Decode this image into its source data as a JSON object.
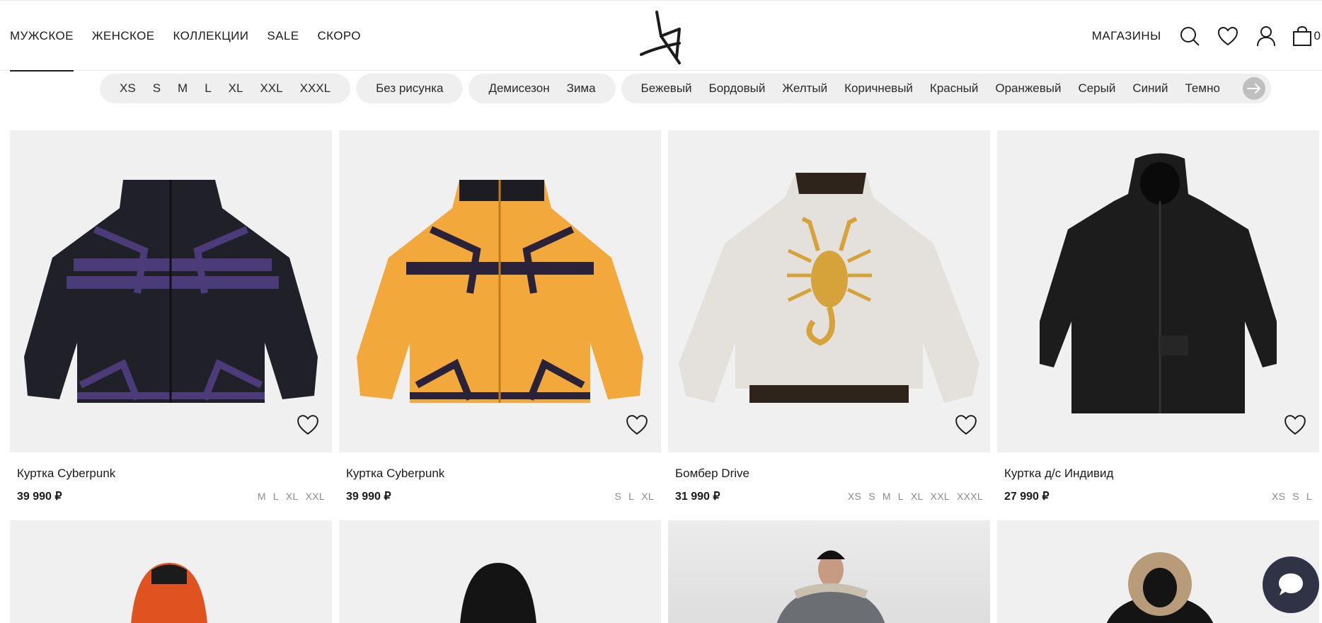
{
  "header": {
    "nav": [
      {
        "label": "МУЖСКОЕ",
        "active": true
      },
      {
        "label": "ЖЕНСКОЕ"
      },
      {
        "label": "КОЛЛЕКЦИИ"
      },
      {
        "label": "SALE"
      },
      {
        "label": "СКОРО"
      }
    ],
    "stores_label": "МАГАЗИНЫ",
    "cart_count": "0"
  },
  "filters": {
    "sizes": [
      "XS",
      "S",
      "M",
      "L",
      "XL",
      "XXL",
      "XXXL"
    ],
    "pattern": [
      "Без рисунка"
    ],
    "season": [
      "Демисезон",
      "Зима"
    ],
    "colors": [
      "Бежевый",
      "Бордовый",
      "Желтый",
      "Коричневый",
      "Красный",
      "Оранжевый",
      "Серый",
      "Синий",
      "Темно"
    ]
  },
  "products": [
    {
      "name": "Куртка Cyberpunk",
      "price": "39 990 ₽",
      "sizes": [
        "M",
        "L",
        "XL",
        "XXL"
      ],
      "colors": {
        "body": "#1e1f26",
        "accent": "#4b3b78"
      }
    },
    {
      "name": "Куртка Cyberpunk",
      "price": "39 990 ₽",
      "sizes": [
        "S",
        "L",
        "XL"
      ],
      "colors": {
        "body": "#f2a83a",
        "accent": "#2a2238"
      }
    },
    {
      "name": "Бомбер Drive",
      "price": "31 990 ₽",
      "sizes": [
        "XS",
        "S",
        "M",
        "L",
        "XL",
        "XXL",
        "XXXL"
      ],
      "colors": {
        "body": "#e4e1dc",
        "accent": "#d6a23a"
      }
    },
    {
      "name": "Куртка д/с Индивид",
      "price": "27 990 ₽",
      "sizes": [
        "XS",
        "S",
        "L"
      ],
      "colors": {
        "body": "#1c1c1c",
        "accent": "#2b2b2b"
      }
    }
  ],
  "theme": {
    "text": "#1b1b1b",
    "pill_bg": "#efefef",
    "chat_bg": "#2f3345"
  }
}
